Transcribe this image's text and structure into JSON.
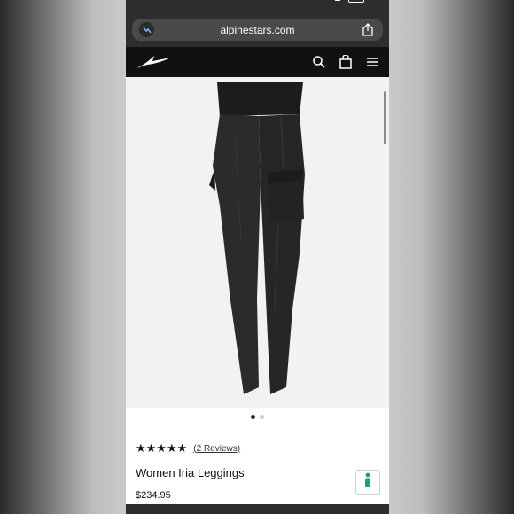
{
  "browser": {
    "url": "alpinestars.com"
  },
  "site_header": {
    "logo": "alpinestars-logo",
    "icons": [
      "search-icon",
      "bag-icon",
      "menu-icon"
    ]
  },
  "gallery": {
    "image": "black-cargo-leggings",
    "dots": 2,
    "active_dot": 1
  },
  "product": {
    "stars": "★★★★★",
    "rating": 5,
    "reviews_link": "(2 Reviews)",
    "title": "Women Iria Leggings",
    "price": "$234.95"
  },
  "colors": {
    "header_bg": "#111111",
    "browser_chrome": "#2d2d2f",
    "accessibility_green": "#1aa36b"
  }
}
